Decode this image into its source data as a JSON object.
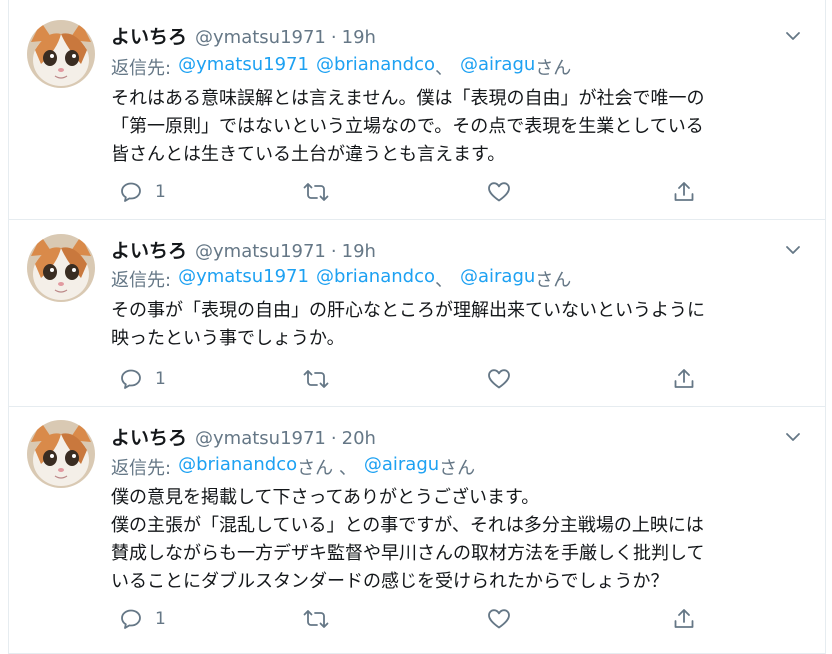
{
  "tweets": [
    {
      "name": "よいちろ",
      "handle": "@ymatsu1971",
      "time": "19h",
      "reply_prefix": "返信先:",
      "reply_to": [
        {
          "text": "@ymatsu1971",
          "suffix": ""
        },
        {
          "text": "@brianandco",
          "suffix": "、"
        },
        {
          "text": "@airagu",
          "suffix": "さん"
        }
      ],
      "lines": [
        "それはある意味誤解とは言えません。僕は「表現の自由」が社会で唯一の",
        "「第一原則」ではないという立場なので。その点で表現を生業としている",
        "皆さんとは生きている土台が違うとも言えます。"
      ],
      "reply_count": "1"
    },
    {
      "name": "よいちろ",
      "handle": "@ymatsu1971",
      "time": "19h",
      "reply_prefix": "返信先:",
      "reply_to": [
        {
          "text": "@ymatsu1971",
          "suffix": ""
        },
        {
          "text": "@brianandco",
          "suffix": "、"
        },
        {
          "text": "@airagu",
          "suffix": "さん"
        }
      ],
      "lines": [
        "その事が「表現の自由」の肝心なところが理解出来ていないというように",
        "映ったという事でしょうか。"
      ],
      "reply_count": "1"
    },
    {
      "name": "よいちろ",
      "handle": "@ymatsu1971",
      "time": "20h",
      "reply_prefix": "返信先:",
      "reply_to": [
        {
          "text": "@brianandco",
          "suffix": "さん 、"
        },
        {
          "text": "@airagu",
          "suffix": "さん"
        }
      ],
      "lines": [
        "僕の意見を掲載して下さってありがとうございます。",
        "僕の主張が「混乱している」との事ですが、それは多分主戦場の上映には",
        "賛成しながらも一方デザキ監督や早川さんの取材方法を手厳しく批判して",
        "いることにダブルスタンダードの感じを受けられたからでしょうか？"
      ],
      "reply_count": "1"
    }
  ],
  "icons": {
    "reply": "reply-icon",
    "retweet": "retweet-icon",
    "like": "heart-icon",
    "share": "share-icon",
    "caret": "chevron-down-icon"
  },
  "colors": {
    "link": "#1da1f2",
    "secondary": "#657786",
    "text": "#14171a",
    "border": "#e6ecf0"
  }
}
